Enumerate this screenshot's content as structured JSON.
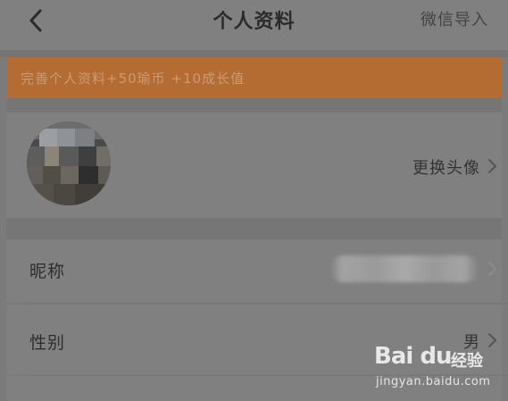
{
  "header": {
    "title": "个人资料",
    "action_label": "微信导入",
    "back_icon": "chevron-left-icon"
  },
  "banner": {
    "text": "完善个人资料+50瑜币 +10成长值"
  },
  "avatar_row": {
    "action_label": "更换头像"
  },
  "rows": [
    {
      "label": "昵称",
      "value": ""
    },
    {
      "label": "性别",
      "value": "男"
    }
  ],
  "watermark": {
    "brand": "Bai du",
    "suffix": "经验",
    "url": "jingyan.baidu.com"
  },
  "colors": {
    "banner_bg": "#b46c33",
    "page_bg": "#808080"
  }
}
